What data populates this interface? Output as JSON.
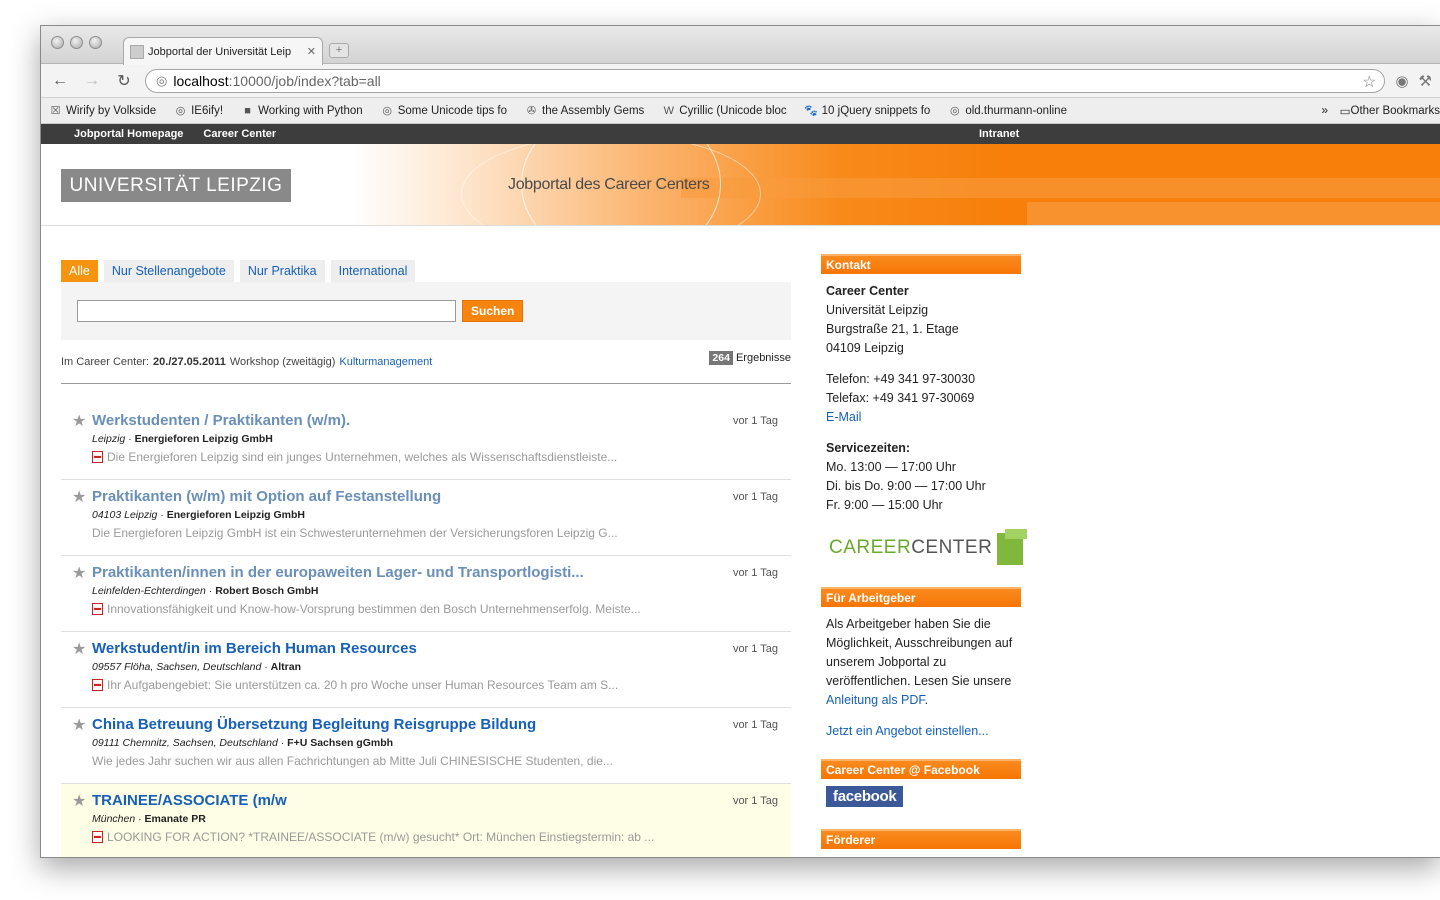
{
  "browser": {
    "tab_title": "Jobportal der Universität Leip",
    "tab_close": "✕",
    "new_tab": "+",
    "url_host": "localhost",
    "url_path": ":10000/job/index?tab=all",
    "bookmarks": [
      {
        "icon": "☒",
        "label": "Wirify by Volkside"
      },
      {
        "icon": "◎",
        "label": "IE6ify!"
      },
      {
        "icon": "■",
        "label": "Working with Python"
      },
      {
        "icon": "◎",
        "label": "Some Unicode tips fo"
      },
      {
        "icon": "✇",
        "label": "the Assembly Gems"
      },
      {
        "icon": "W",
        "label": "Cyrillic (Unicode bloc"
      },
      {
        "icon": "🐾",
        "label": "10 jQuery snippets fo"
      },
      {
        "icon": "◎",
        "label": "old.thurmann-online"
      }
    ],
    "bookmarks_more": "»",
    "other_bookmarks": "Other Bookmarks"
  },
  "topnav": {
    "home": "Jobportal Homepage",
    "career": "Career Center",
    "intranet": "Intranet"
  },
  "banner": {
    "uni_logo": "UNIVERSITÄT LEIPZIG",
    "portal_title": "Jobportal des Career Centers"
  },
  "tabs": [
    "Alle",
    "Nur Stellenangebote",
    "Nur Praktika",
    "International"
  ],
  "search": {
    "button": "Suchen",
    "value": ""
  },
  "info": {
    "prefix": "Im Career Center:",
    "date": "20./27.05.2011",
    "event": "Workshop (zweitägig)",
    "link": "Kulturmanagement",
    "results_count": "264",
    "results_label": "Ergebnisse"
  },
  "jobs": [
    {
      "title": "Werkstudenten / Praktikanten (w/m).",
      "location": "Leipzig",
      "company": "Energieforen Leipzig GmbH",
      "desc": "Die Energieforen Leipzig sind ein junges Unternehmen, welches als Wissenschaftsdienstleiste...",
      "age": "vor 1 Tag",
      "pdf": true,
      "visited": true
    },
    {
      "title": "Praktikanten (w/m) mit Option auf Festanstellung",
      "location": "04103 Leipzig",
      "company": "Energieforen Leipzig GmbH",
      "desc": "Die Energieforen Leipzig GmbH ist ein Schwesterunternehmen der Versicherungsforen Leipzig G...",
      "age": "vor 1 Tag",
      "pdf": false,
      "visited": true
    },
    {
      "title": "Praktikanten/innen in der europaweiten Lager- und Transportlogisti...",
      "location": "Leinfelden-Echterdingen",
      "company": "Robert Bosch GmbH",
      "desc": "Innovationsfähigkeit und Know-how-Vorsprung bestimmen den Bosch Unternehmenserfolg. Meiste...",
      "age": "vor 1 Tag",
      "pdf": true,
      "visited": true
    },
    {
      "title": "Werkstudent/in im Bereich Human Resources",
      "location": "09557 Flöha, Sachsen, Deutschland",
      "company": "Altran",
      "desc": "Ihr Aufgabengebiet: Sie unterstützen ca. 20 h pro Woche unser Human Resources Team am S...",
      "age": "vor 1 Tag",
      "pdf": true,
      "visited": false
    },
    {
      "title": "China Betreuung Übersetzung Begleitung Reisgruppe Bildung",
      "location": "09111 Chemnitz, Sachsen, Deutschland",
      "company": "F+U Sachsen gGmbh",
      "desc": "Wie jedes Jahr suchen wir aus allen Fachrichtungen ab Mitte Juli CHINESISCHE Studenten, die...",
      "age": "vor 1 Tag",
      "pdf": false,
      "visited": false
    },
    {
      "title": "TRAINEE/ASSOCIATE (m/w",
      "location": "München",
      "company": "Emanate PR",
      "desc": "LOOKING FOR ACTION? *TRAINEE/ASSOCIATE (m/w) gesucht* Ort: München Einstiegstermin: ab ...",
      "age": "vor 1 Tag",
      "pdf": true,
      "visited": false,
      "highlight": true
    }
  ],
  "sidebar": {
    "kontakt_head": "Kontakt",
    "cc_name": "Career Center",
    "address": [
      "Universität Leipzig",
      "Burgstraße 21, 1. Etage",
      "04109 Leipzig"
    ],
    "telefon": "Telefon: +49 341 97-30030",
    "telefax": "Telefax: +49 341 97-30069",
    "email": "E-Mail",
    "service_head": "Servicezeiten:",
    "service": [
      "Mo. 13:00 — 17:00 Uhr",
      "Di. bis Do. 9:00 — 17:00 Uhr",
      "Fr. 9:00 — 15:00 Uhr"
    ],
    "logo_green": "CAREER",
    "logo_grey": "CENTER",
    "arbeitgeber_head": "Für Arbeitgeber",
    "arbeitgeber_text": "Als Arbeitgeber haben Sie die Möglichkeit, Ausschreibungen auf unserem Jobportal zu veröffentlichen. Lesen Sie unsere",
    "arbeitgeber_link": "Anleitung als PDF",
    "arbeitgeber_after": ".",
    "angebot_link": "Jetzt ein Angebot einstellen...",
    "facebook_head": "Career Center @ Facebook",
    "facebook_btn": "facebook",
    "foerderer_head": "Förderer"
  },
  "colors": {
    "accent": "#f7840d",
    "link": "#1660b8",
    "topnav": "#3d3d3d"
  }
}
